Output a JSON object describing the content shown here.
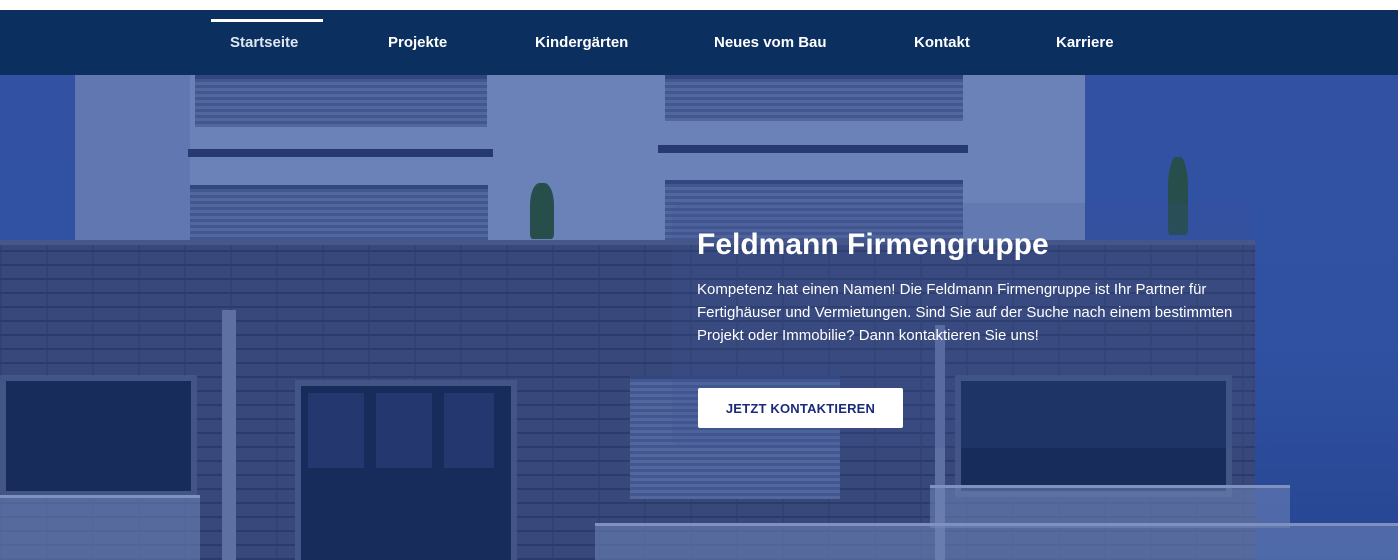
{
  "nav": {
    "items": [
      {
        "label": "Startseite",
        "active": true
      },
      {
        "label": "Projekte",
        "active": false
      },
      {
        "label": "Kindergärten",
        "active": false
      },
      {
        "label": "Neues vom Bau",
        "active": false
      },
      {
        "label": "Kontakt",
        "active": false
      },
      {
        "label": "Karriere",
        "active": false
      }
    ]
  },
  "hero": {
    "title": "Feldmann Firmengruppe",
    "description": "Kompetenz hat einen Namen! Die Feldmann Firmengruppe ist Ihr Partner für Fertighäuser und Vermietungen. Sind Sie auf der Suche nach einem bestimmten Projekt oder Immobilie? Dann kontaktieren Sie uns!",
    "cta_label": "JETZT KONTAKTIEREN"
  },
  "colors": {
    "nav_background": "#0b2f5f",
    "hero_overlay": "#1b3a73",
    "cta_text": "#1a2b7a"
  }
}
